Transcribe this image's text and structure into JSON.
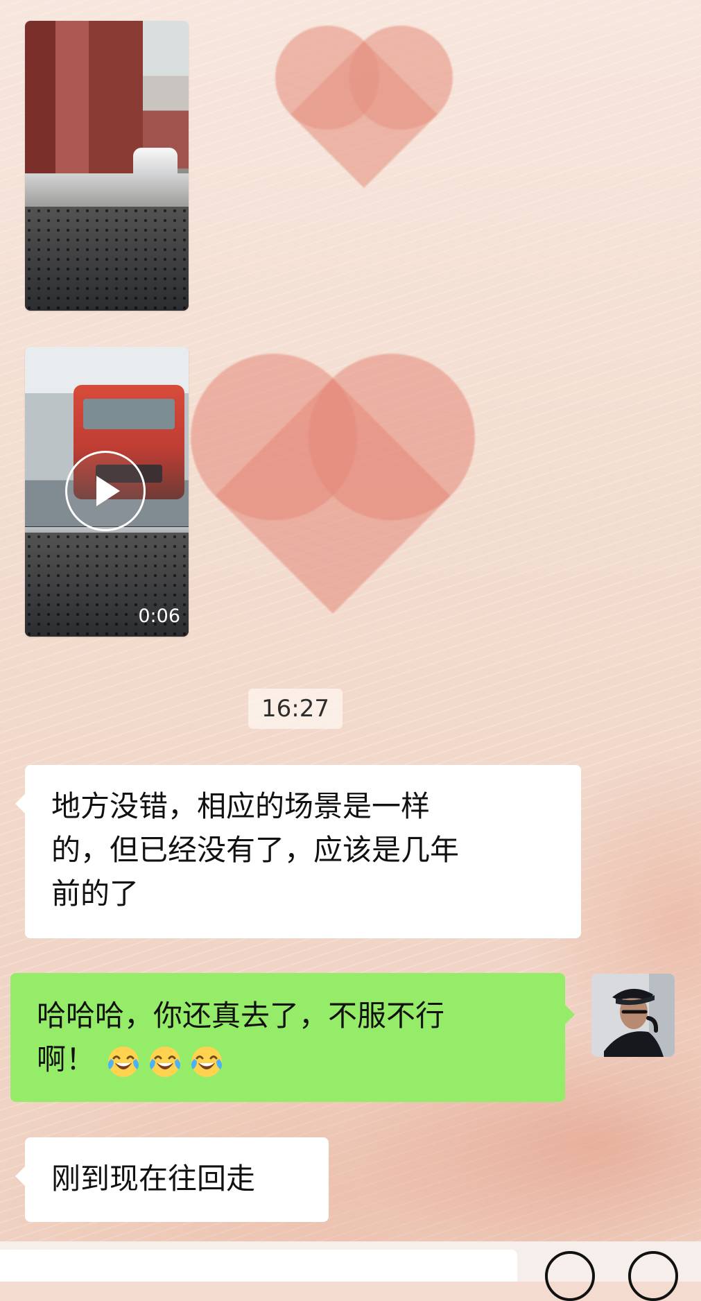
{
  "chat": {
    "timestamp": "16:27",
    "video_duration": "0:06",
    "messages": [
      {
        "side": "left",
        "lines": [
          "地方没错，相应的场景是一样",
          "的，但已经没有了，应该是几年",
          "前的了"
        ]
      },
      {
        "side": "right",
        "lines": [
          "哈哈哈，你还真去了，不服不行",
          "啊！"
        ],
        "emojis": [
          "tears-of-joy-icon",
          "tears-of-joy-icon",
          "tears-of-joy-icon"
        ]
      },
      {
        "side": "left",
        "lines": [
          "刚到现在往回走"
        ]
      }
    ]
  },
  "colors": {
    "background": "#f3dccf",
    "incoming_bubble": "#ffffff",
    "outgoing_bubble": "#95ec69",
    "text": "#111111"
  }
}
